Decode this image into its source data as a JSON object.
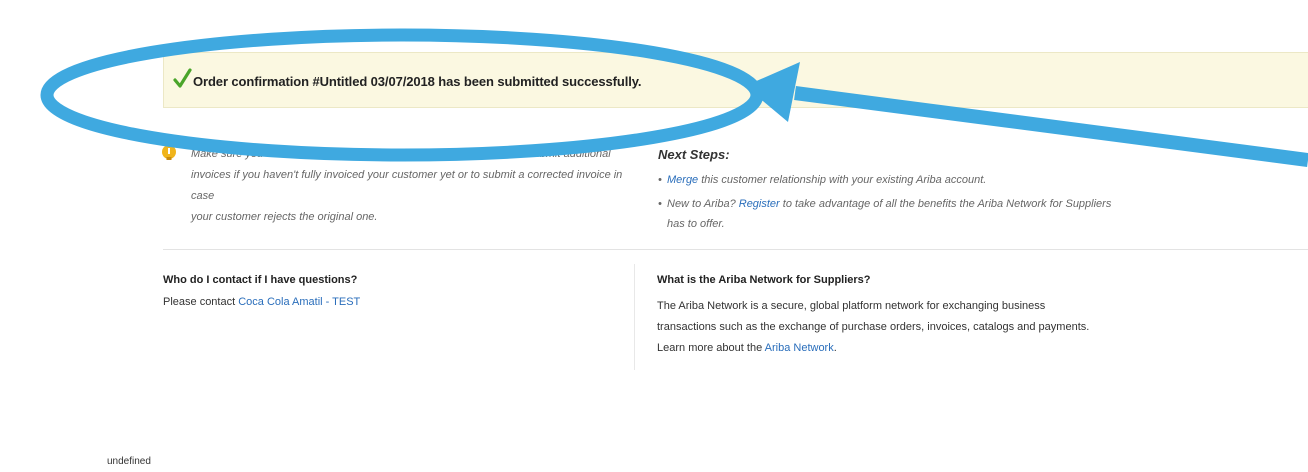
{
  "banner": {
    "icon": "checkmark-icon",
    "message": "Order confirmation #Untitled 03/07/2018 has been submitted successfully.",
    "color": "#fbf8e1"
  },
  "tip": {
    "icon": "lightbulb-icon",
    "line1": "Make sure you",
    "line1_end": "submit additional",
    "line2": "invoices if you haven't fully invoiced your customer yet or to submit a corrected invoice in case",
    "line3": "your customer rejects the original one."
  },
  "next_steps": {
    "title": "Next Steps:",
    "item1_link": "Merge",
    "item1_rest": " this customer relationship with your existing Ariba account.",
    "item2_pre": "New to Ariba? ",
    "item2_link": "Register",
    "item2_rest": " to take advantage of all the benefits the Ariba Network for Suppliers has to offer."
  },
  "contact": {
    "title": "Who do I contact if I have questions?",
    "prefix": "Please contact ",
    "link": "Coca Cola Amatil - TEST"
  },
  "about": {
    "title": "What is the Ariba Network for Suppliers?",
    "text": "The Ariba Network is a secure, global platform network for exchanging business transactions such as the exchange of purchase orders, invoices, catalogs and payments. Learn more about the ",
    "link": "Ariba Network",
    "suffix": "."
  },
  "footer": {
    "text": "undefined"
  },
  "colors": {
    "link": "#2a6ebb",
    "annotation": "#3fa9e0"
  }
}
